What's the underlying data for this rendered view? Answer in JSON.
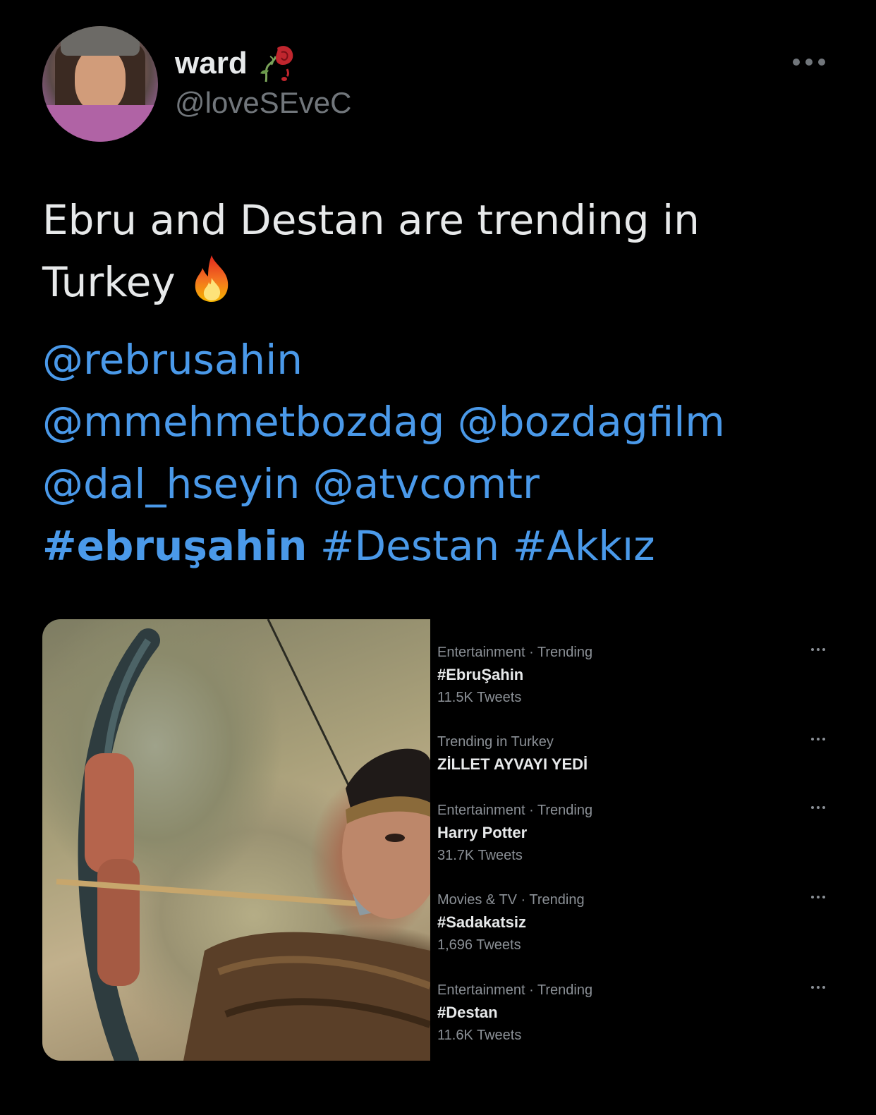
{
  "author": {
    "display_name": "ward",
    "handle": "@loveSEveC",
    "name_emoji_icon": "wilted-rose-icon",
    "avatar_icon": "avatar"
  },
  "tweet": {
    "text_line1": "Ebru and Destan are trending in",
    "text_line2": "Turkey",
    "emoji_icon": "fire-icon",
    "mentions": [
      "@rebrusahin",
      "@mmehmetbozdag",
      "@bozdagfilm",
      "@dal_hseyin",
      "@atvcomtr"
    ],
    "hashtags": [
      "#ebruşahin",
      "#Destan",
      "#Akkız"
    ]
  },
  "trends": [
    {
      "meta": "Entertainment · Trending",
      "title": "#EbruŞahin",
      "count": "11.5K Tweets"
    },
    {
      "meta": "Trending in Turkey",
      "title": "ZİLLET AYVAYI YEDİ",
      "count": ""
    },
    {
      "meta": "Entertainment · Trending",
      "title": "Harry Potter",
      "count": "31.7K Tweets"
    },
    {
      "meta": "Movies & TV · Trending",
      "title": "#Sadakatsiz",
      "count": "1,696 Tweets"
    },
    {
      "meta": "Entertainment · Trending",
      "title": "#Destan",
      "count": "11.6K Tweets"
    }
  ],
  "colors": {
    "background": "#000000",
    "text": "#e7e9ea",
    "secondary": "#71767b",
    "link": "#4a99e9"
  }
}
